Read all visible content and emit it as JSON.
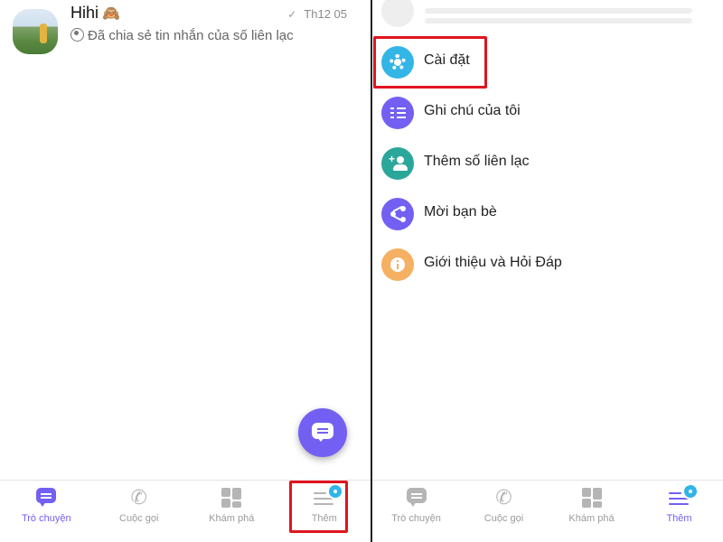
{
  "left_screen": {
    "chat": {
      "title": "Hihi",
      "emoji": "🙈",
      "time": "Th12 05",
      "preview": "Đã chia sẻ tin nhắn của số liên lạc"
    },
    "nav": [
      {
        "label": "Trò chuyện",
        "icon": "chat-bubble-icon",
        "active": true
      },
      {
        "label": "Cuộc gọi",
        "icon": "phone-icon",
        "active": false
      },
      {
        "label": "Khám phá",
        "icon": "explore-grid-icon",
        "active": false
      },
      {
        "label": "Thêm",
        "icon": "menu-icon",
        "active": false,
        "badge": true
      }
    ]
  },
  "right_screen": {
    "menu": [
      {
        "label": "Cài đặt",
        "icon": "gear-icon",
        "color": "#33b5e6"
      },
      {
        "label": "Ghi chú của tôi",
        "icon": "checklist-icon",
        "color": "#7360f2"
      },
      {
        "label": "Thêm số liên lạc",
        "icon": "add-contact-icon",
        "color": "#2ba69a"
      },
      {
        "label": "Mời bạn bè",
        "icon": "share-icon",
        "color": "#7360f2"
      },
      {
        "label": "Giới thiệu và Hỏi Đáp",
        "icon": "info-icon",
        "color": "#f5b063"
      }
    ],
    "nav": [
      {
        "label": "Trò chuyện",
        "icon": "chat-bubble-icon",
        "active": false
      },
      {
        "label": "Cuộc gọi",
        "icon": "phone-icon",
        "active": false
      },
      {
        "label": "Khám phá",
        "icon": "explore-grid-icon",
        "active": false
      },
      {
        "label": "Thêm",
        "icon": "menu-icon",
        "active": true,
        "badge": true
      }
    ]
  },
  "colors": {
    "accent": "#7360f2",
    "highlight": "#e0141f",
    "badge": "#31b4e8",
    "inactive": "#9b9b9b"
  }
}
